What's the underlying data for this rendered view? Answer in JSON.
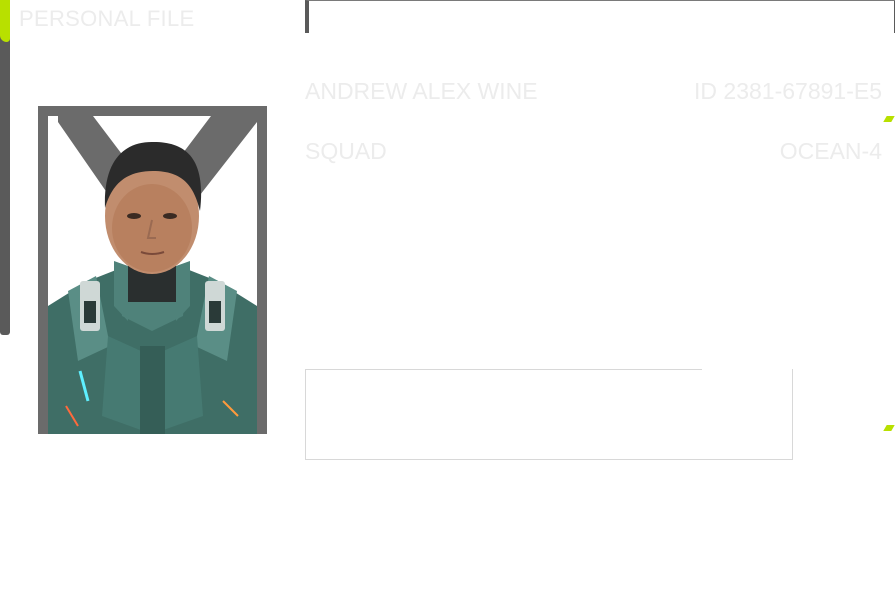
{
  "header": {
    "title": "PERSONAL FILE"
  },
  "profile": {
    "name": "ANDREW ALEX WINE",
    "id": "ID 2381-67891-E5",
    "squad_label": "SQUAD",
    "squad_value": "OCEAN-4"
  },
  "icons": {
    "photo": "soldier-portrait-icon",
    "accent": "accent-tick-icon"
  },
  "colors": {
    "accent": "#b8e000",
    "frame": "#6b6b6b",
    "text_faint": "#ececec",
    "armor": "#3f6e66"
  }
}
